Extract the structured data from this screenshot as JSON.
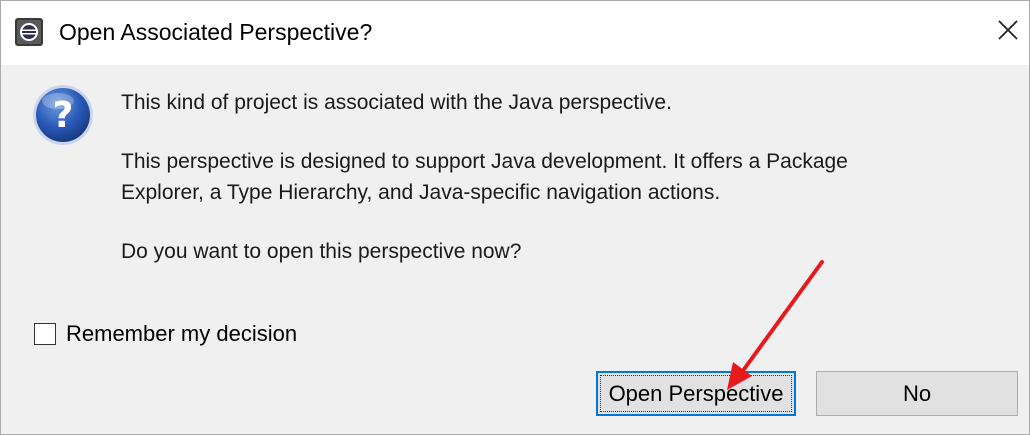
{
  "window": {
    "title": "Open Associated Perspective?",
    "app_icon": "eclipse-icon",
    "close_icon": "close-icon"
  },
  "message": {
    "icon": "question-icon",
    "line1": "This kind of project is associated with the Java perspective.",
    "line2a": "This perspective is designed to support Java development. It offers a Package",
    "line2b": "Explorer, a Type Hierarchy, and Java-specific navigation actions.",
    "line3": "Do you want to open this perspective now?"
  },
  "remember": {
    "label": "Remember my decision",
    "checked": false
  },
  "buttons": {
    "open_label": "Open Perspective",
    "no_label": "No"
  },
  "annotation": {
    "arrow_color": "#e8191d"
  },
  "colors": {
    "dialog_bg": "#f0f0f0",
    "default_button_border": "#0078d7",
    "question_icon_blue": "#1f4fa3"
  }
}
